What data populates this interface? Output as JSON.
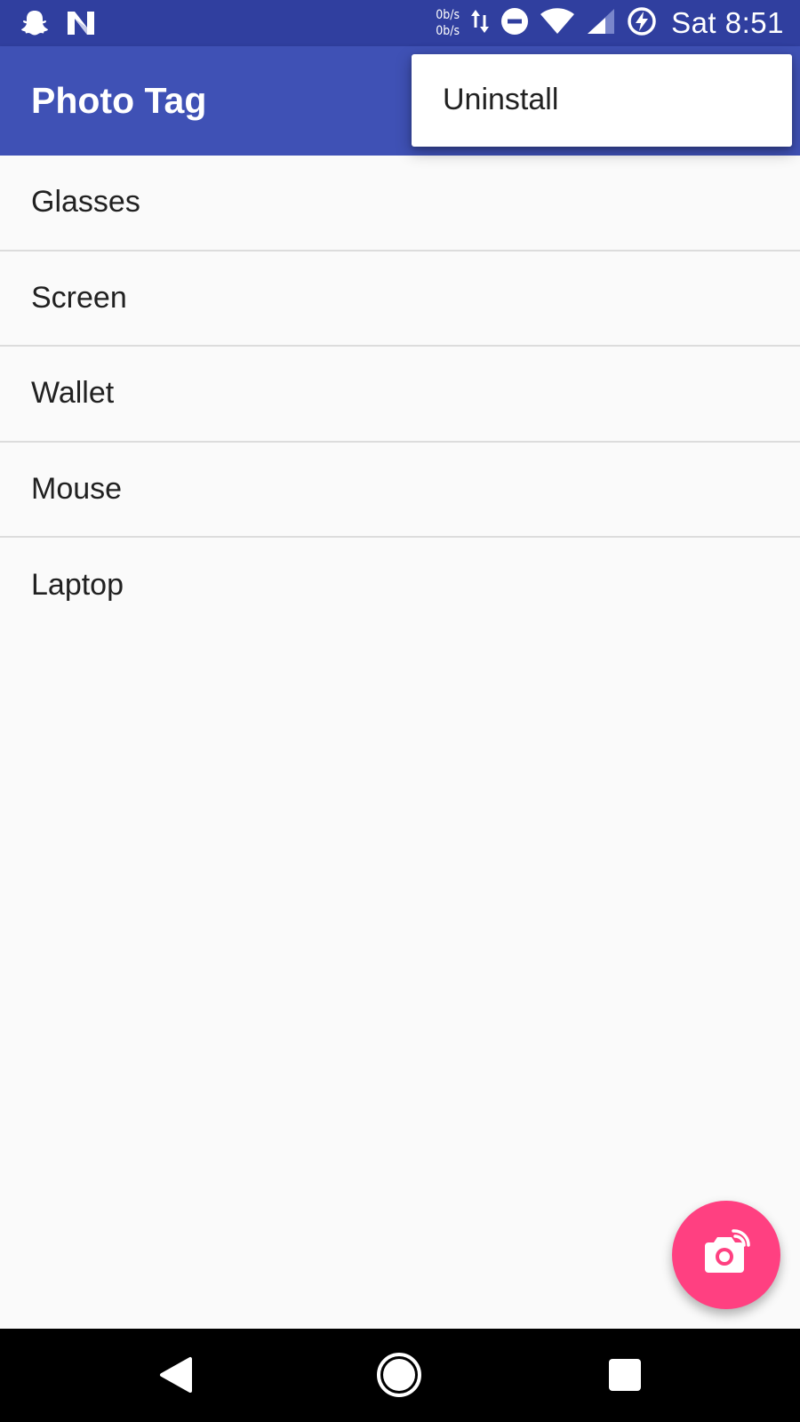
{
  "status_bar": {
    "net_up": "0b/s",
    "net_down": "0b/s",
    "time": "Sat 8:51",
    "left_icons": [
      "snapchat-icon",
      "n-notification-icon"
    ],
    "right_icons": [
      "data-transfer-icon",
      "do-not-disturb-icon",
      "wifi-icon",
      "cell-signal-icon",
      "battery-charging-icon"
    ],
    "background": "#303f9f"
  },
  "app_bar": {
    "title": "Photo Tag",
    "background": "#3f51b5"
  },
  "list": {
    "items": [
      {
        "label": "Glasses"
      },
      {
        "label": "Screen"
      },
      {
        "label": "Wallet"
      },
      {
        "label": "Mouse"
      },
      {
        "label": "Laptop"
      }
    ]
  },
  "overflow_menu": {
    "items": [
      {
        "label": "Uninstall"
      }
    ]
  },
  "fab": {
    "icon": "camera-switch-icon",
    "color": "#ff4081"
  },
  "nav_bar": {
    "buttons": [
      "back-icon",
      "home-icon",
      "recents-icon"
    ]
  }
}
